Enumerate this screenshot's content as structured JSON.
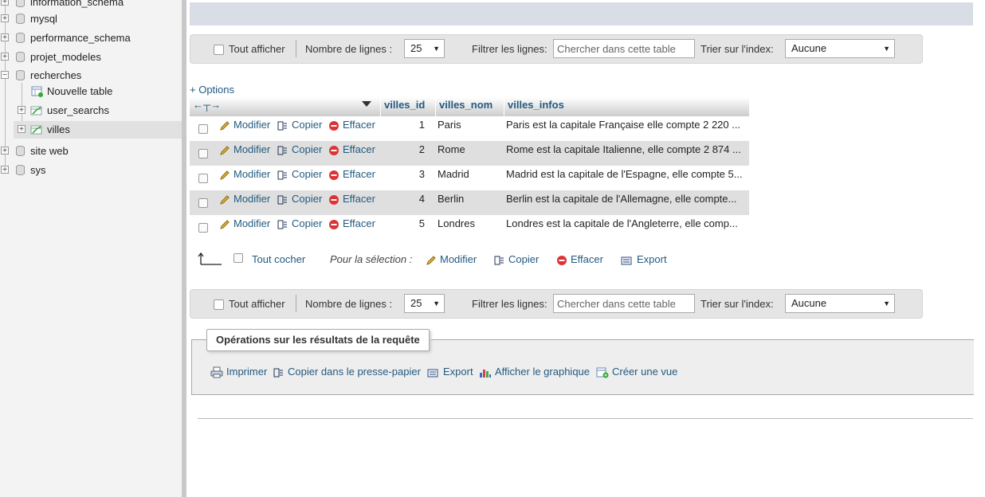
{
  "nav": {
    "databases": [
      {
        "label": "information_schema",
        "expander": "+"
      },
      {
        "label": "mysql",
        "expander": "+"
      },
      {
        "label": "performance_schema",
        "expander": "+"
      },
      {
        "label": "projet_modeles",
        "expander": "+"
      },
      {
        "label": "recherches",
        "expander": "−"
      },
      {
        "label": "site web",
        "expander": "+"
      },
      {
        "label": "sys",
        "expander": "+"
      }
    ],
    "tables": [
      {
        "label": "Nouvelle table"
      },
      {
        "label": "user_searchs",
        "expander": "+"
      },
      {
        "label": "villes",
        "expander": "+"
      }
    ]
  },
  "navbar": {
    "show_all": "Tout afficher",
    "rows_label": "Nombre de lignes :",
    "rows_value": "25",
    "filter_label": "Filtrer les lignes:",
    "filter_placeholder": "Chercher dans cette table",
    "sort_label": "Trier sur l'index:",
    "sort_value": "Aucune"
  },
  "options_link": "+ Options",
  "table": {
    "columns": [
      "villes_id",
      "villes_nom",
      "villes_infos"
    ],
    "row_actions": {
      "edit": "Modifier",
      "copy": "Copier",
      "delete": "Effacer"
    },
    "rows": [
      {
        "id": "1",
        "nom": "Paris",
        "infos": "Paris est la capitale Française elle compte 2 220 ..."
      },
      {
        "id": "2",
        "nom": "Rome",
        "infos": "Rome est la capitale Italienne, elle compte 2 874 ..."
      },
      {
        "id": "3",
        "nom": "Madrid",
        "infos": "Madrid est la capitale de l'Espagne, elle compte 5..."
      },
      {
        "id": "4",
        "nom": "Berlin",
        "infos": "Berlin est la capitale de l'Allemagne, elle compte..."
      },
      {
        "id": "5",
        "nom": "Londres",
        "infos": "Londres est la capitale de l'Angleterre, elle comp..."
      }
    ]
  },
  "selection": {
    "check_all": "Tout cocher",
    "label": "Pour la sélection :",
    "edit": "Modifier",
    "copy": "Copier",
    "delete": "Effacer",
    "export": "Export"
  },
  "operations": {
    "legend": "Opérations sur les résultats de la requête",
    "print": "Imprimer",
    "copy_clipboard": "Copier dans le presse-papier",
    "export": "Export",
    "chart": "Afficher le graphique",
    "create_view": "Créer une vue"
  },
  "colors": {
    "link": "#235a81",
    "row_alt": "#dfdfdf",
    "nav_bg": "#f3f3f3"
  }
}
